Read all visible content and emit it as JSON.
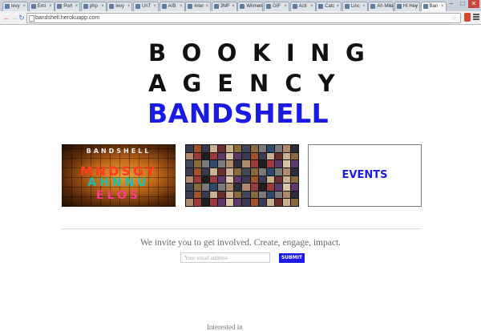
{
  "browser": {
    "tabs": [
      {
        "label": "levy",
        "active": false
      },
      {
        "label": "Emi",
        "active": false
      },
      {
        "label": "Port",
        "active": false
      },
      {
        "label": "php",
        "active": false
      },
      {
        "label": "levy",
        "active": false
      },
      {
        "label": "UnT",
        "active": false
      },
      {
        "label": "A/B",
        "active": false
      },
      {
        "label": "Inter",
        "active": false
      },
      {
        "label": "3MF",
        "active": false
      },
      {
        "label": "Wiimen",
        "active": false
      },
      {
        "label": "GIF",
        "active": false
      },
      {
        "label": "Acti",
        "active": false
      },
      {
        "label": "Calc",
        "active": false
      },
      {
        "label": "Linc",
        "active": false
      },
      {
        "label": "Ah Mila",
        "active": false
      },
      {
        "label": "Hi Hey",
        "active": false
      },
      {
        "label": "Ban",
        "active": true
      }
    ],
    "window_controls": {
      "minimize": "–",
      "maximize": "□",
      "close": "✕"
    },
    "nav": {
      "back": "←",
      "forward": "→",
      "reload": "↻"
    },
    "url": "bandshell.herokuapp.com",
    "colors": {
      "accent": "#1a1ae6"
    }
  },
  "logo": {
    "line1": "BOOKING",
    "line2": "AGENCY",
    "line3": "BANDSHELL"
  },
  "cards": {
    "booking_art": {
      "line1": "BANDSHELL",
      "line2": "MNDSGY",
      "line3": "AHNNU",
      "line4": "ELOS"
    },
    "events_label": "EVENTS"
  },
  "signup": {
    "invite_text": "We invite you to get involved. Create, engage, impact.",
    "email_placeholder": "Your email address",
    "submit_label": "SUBMIT"
  },
  "footer": {
    "partial_text": "Interested in"
  }
}
